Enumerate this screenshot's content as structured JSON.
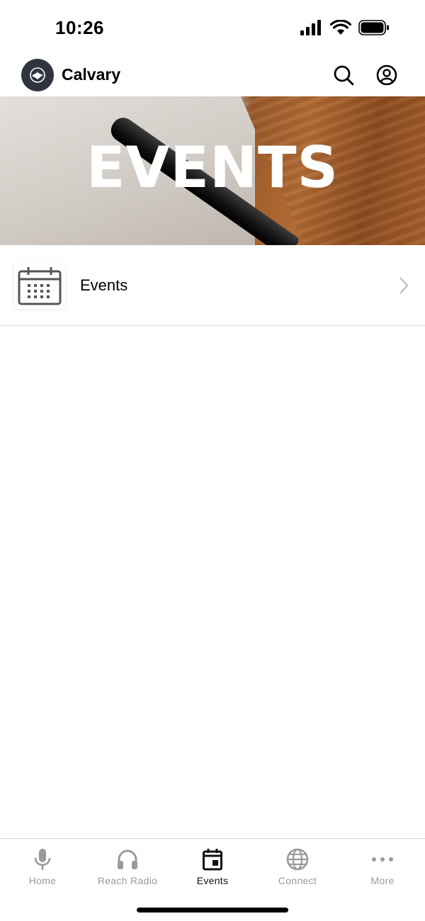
{
  "status_bar": {
    "time": "10:26"
  },
  "header": {
    "title": "Calvary",
    "logo_icon": "flame-dove-logo",
    "search_icon": "search-icon",
    "account_icon": "user-circle-icon"
  },
  "banner": {
    "title": "EVENTS"
  },
  "list": {
    "items": [
      {
        "label": "Events",
        "icon": "calendar-icon"
      }
    ]
  },
  "tab_bar": {
    "active": "Events",
    "tabs": [
      {
        "label": "Home",
        "icon": "microphone-icon"
      },
      {
        "label": "Reach Radio",
        "icon": "headphones-icon"
      },
      {
        "label": "Events",
        "icon": "calendar-icon"
      },
      {
        "label": "Connect",
        "icon": "globe-icon"
      },
      {
        "label": "More",
        "icon": "more-dots-icon"
      }
    ]
  },
  "colors": {
    "logo_bg": "#2f3440",
    "active_tab": "#111111",
    "inactive_tab": "#9a9a9a",
    "divider": "#dcdcdc"
  }
}
